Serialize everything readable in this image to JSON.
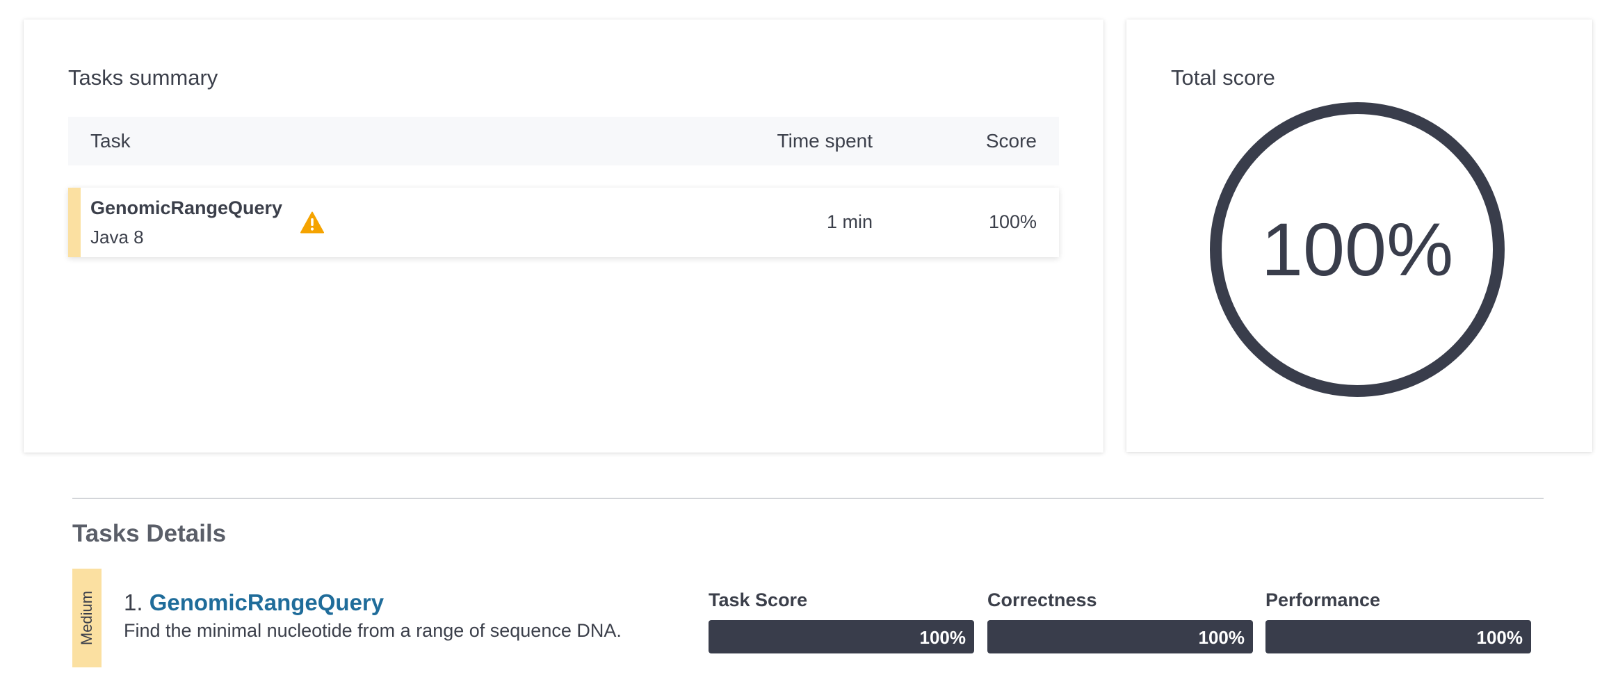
{
  "summary": {
    "title": "Tasks summary",
    "columns": {
      "task": "Task",
      "time_spent": "Time spent",
      "score": "Score"
    },
    "rows": [
      {
        "name": "GenomicRangeQuery",
        "language": "Java 8",
        "time_spent": "1 min",
        "score": "100%",
        "icon": "warning-icon"
      }
    ]
  },
  "total": {
    "title": "Total score",
    "value": "100%"
  },
  "details": {
    "title": "Tasks Details",
    "tasks": [
      {
        "difficulty": "Medium",
        "number": "1.",
        "name": "GenomicRangeQuery",
        "description": "Find the minimal nucleotide from a range of sequence DNA.",
        "metrics": {
          "task_score": {
            "label": "Task Score",
            "value": "100%"
          },
          "correctness": {
            "label": "Correctness",
            "value": "100%"
          },
          "performance": {
            "label": "Performance",
            "value": "100%"
          }
        }
      }
    ]
  },
  "colors": {
    "accent_dark": "#393d4b",
    "difficulty_medium": "#fbe0a1",
    "link": "#1f6c9a",
    "warning": "#f5a300"
  }
}
